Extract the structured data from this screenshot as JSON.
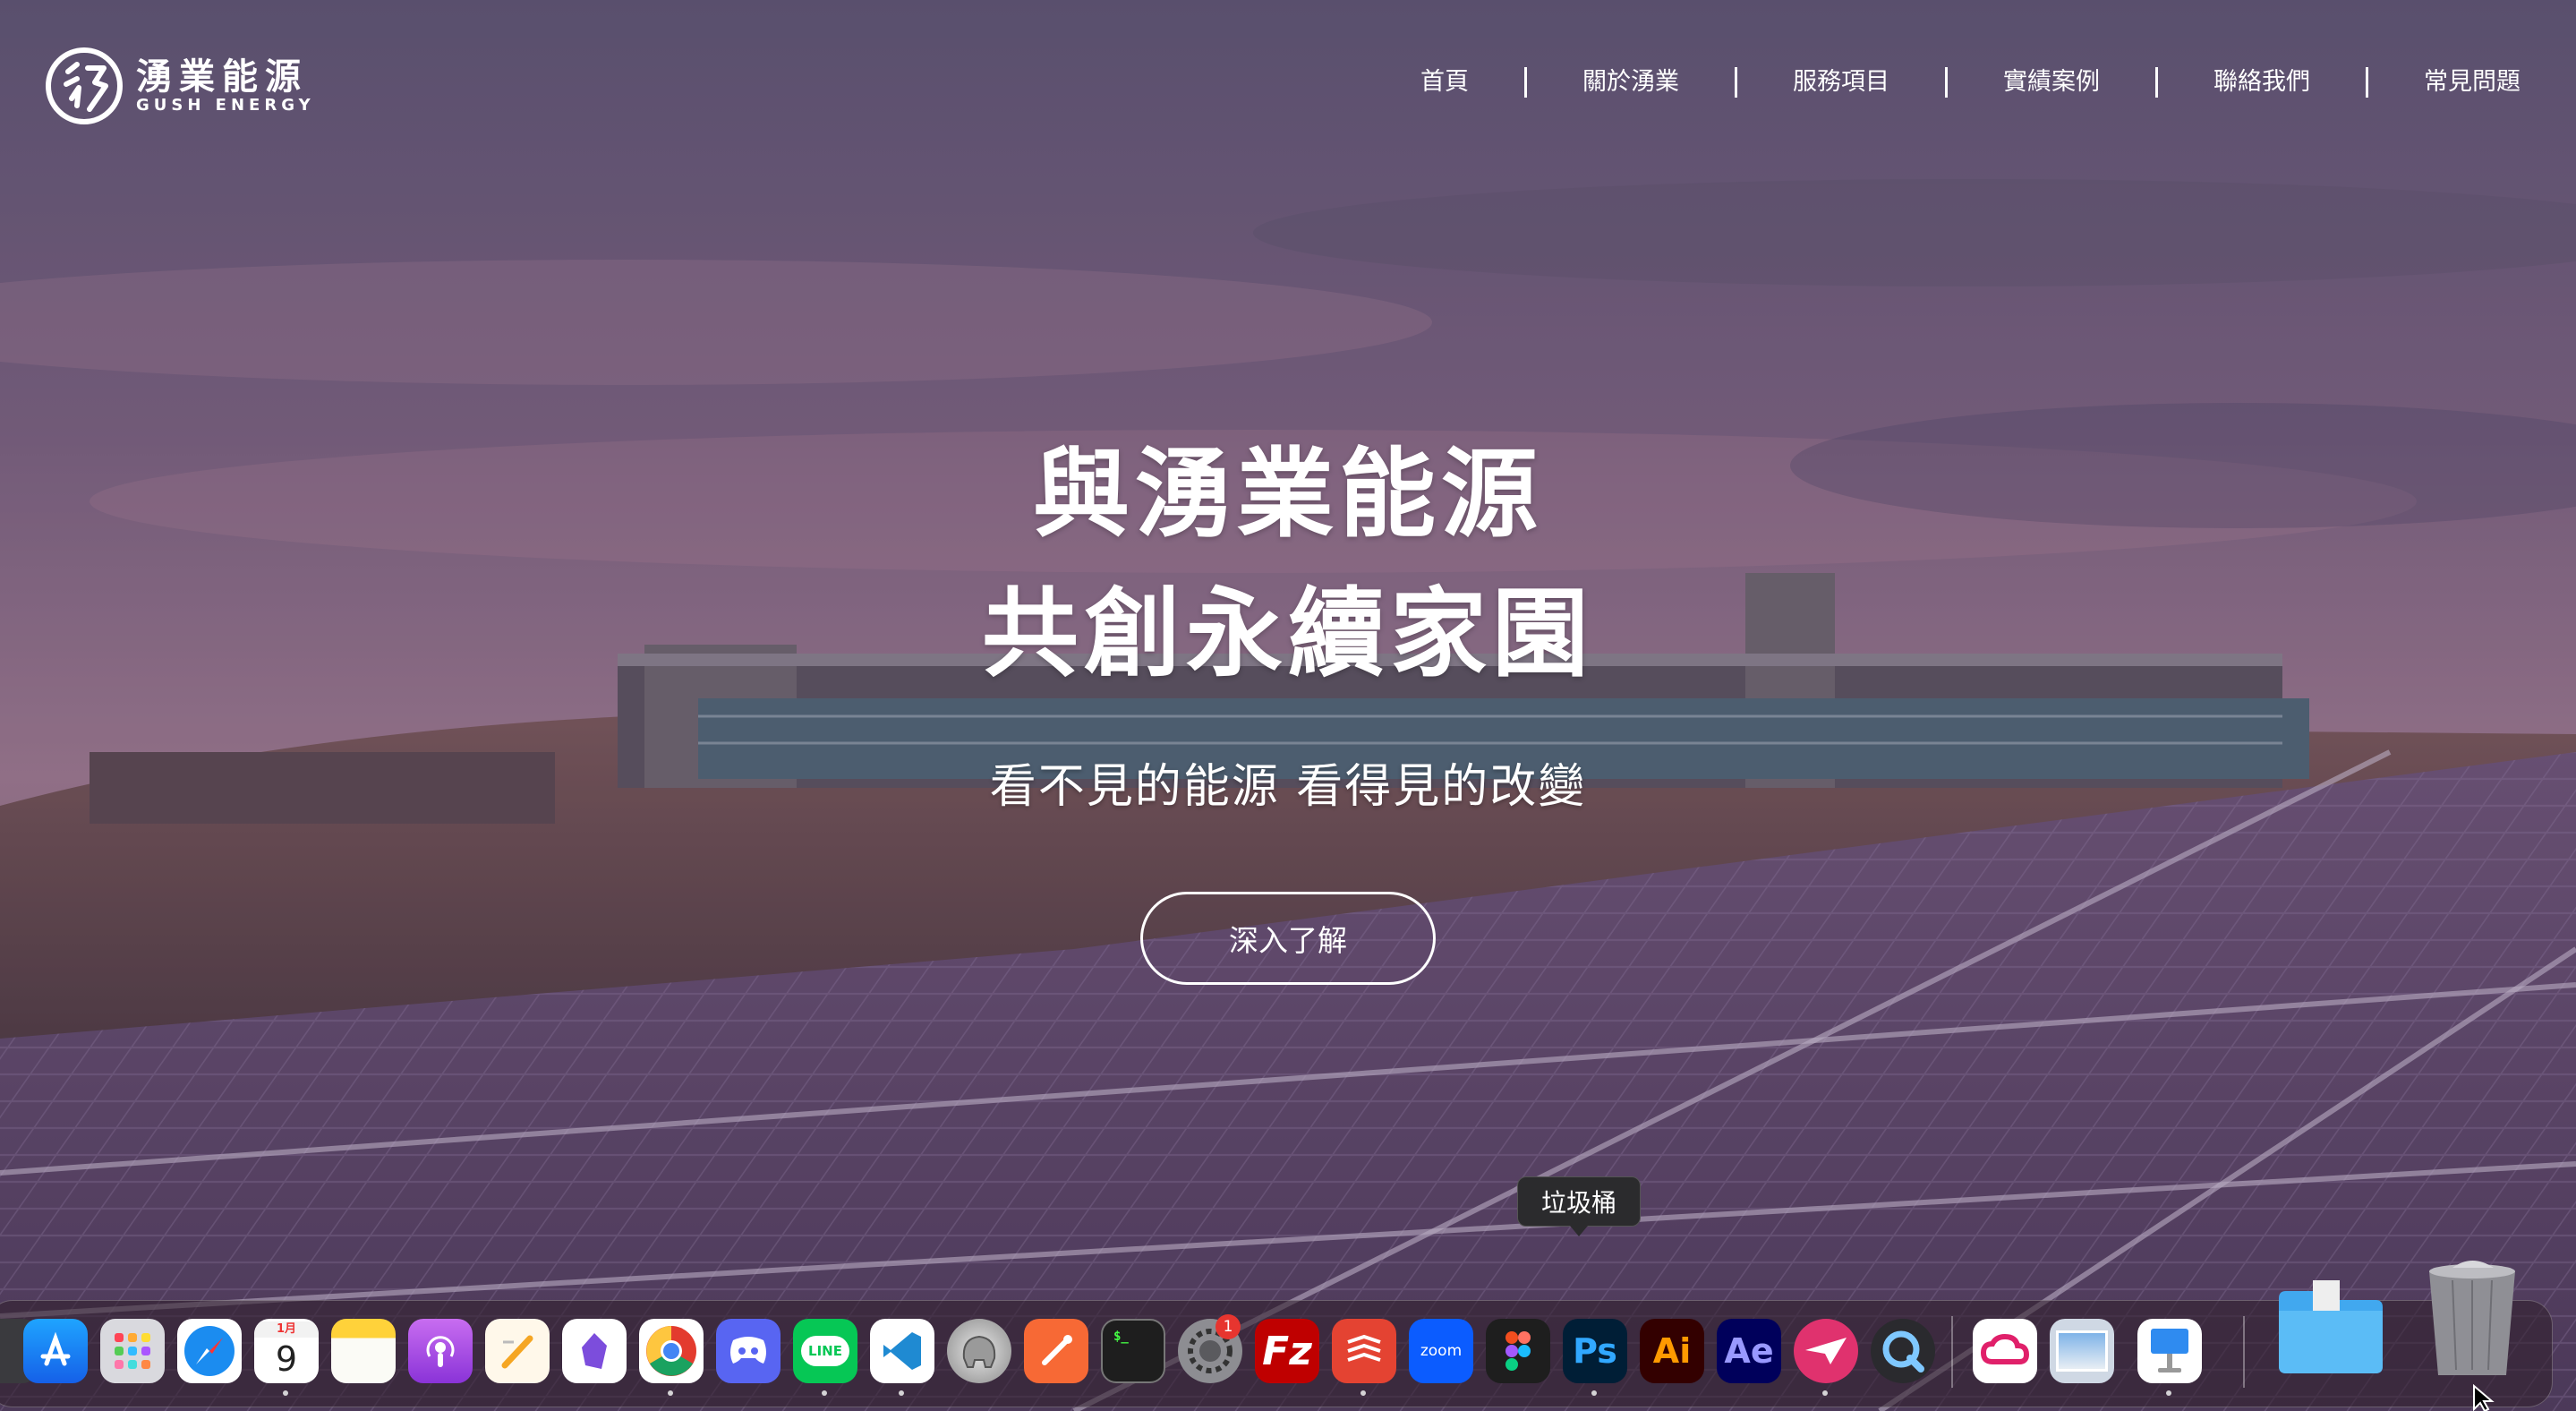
{
  "brand": {
    "name_cn": "湧業能源",
    "name_en": "GUSH ENERGY"
  },
  "nav": {
    "items": [
      {
        "label": "首頁"
      },
      {
        "label": "關於湧業"
      },
      {
        "label": "服務項目"
      },
      {
        "label": "實績案例"
      },
      {
        "label": "聯絡我們"
      },
      {
        "label": "常見問題"
      }
    ]
  },
  "hero": {
    "title_line1": "與湧業能源",
    "title_line2": "共創永續家園",
    "subtitle": "看不見的能源 看得見的改變",
    "cta_label": "深入了解"
  },
  "dock": {
    "tooltip": "垃圾桶",
    "calendar_month": "1月",
    "calendar_day": "9",
    "settings_badge": "1",
    "labels": {
      "line": "LINE",
      "zoom": "zoom",
      "ps": "Ps",
      "ai": "Ai",
      "ae": "Ae",
      "fz": "Fz"
    },
    "icons": [
      "app-store-icon",
      "launchpad-icon",
      "safari-icon",
      "calendar-icon",
      "notes-icon",
      "podcasts-icon",
      "pages-icon",
      "obsidian-icon",
      "chrome-icon",
      "discord-icon",
      "line-icon",
      "vscode-icon",
      "sequel-ace-icon",
      "postman-icon",
      "terminal-icon",
      "system-settings-icon",
      "filezilla-icon",
      "todoist-icon",
      "zoom-icon",
      "figma-icon",
      "photoshop-icon",
      "illustrator-icon",
      "after-effects-icon",
      "airmail-icon",
      "quicktime-icon",
      "creative-cloud-icon",
      "preview-icon",
      "keynote-icon",
      "downloads-folder-icon",
      "trash-icon"
    ]
  },
  "colors": {
    "accent_white": "#ffffff",
    "sky_purple": "#6b5670",
    "badge_red": "#e7352f"
  }
}
